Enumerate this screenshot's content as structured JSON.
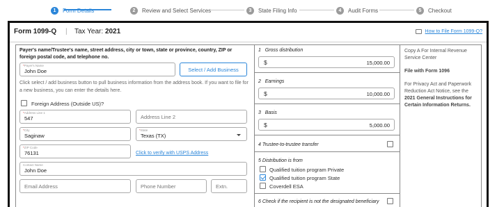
{
  "stepper": {
    "steps": [
      {
        "num": "1",
        "label": "Form Details"
      },
      {
        "num": "2",
        "label": "Review and Select Services"
      },
      {
        "num": "3",
        "label": "State Filing Info"
      },
      {
        "num": "4",
        "label": "Audit Forms"
      },
      {
        "num": "5",
        "label": "Checkout"
      }
    ],
    "active_index": 0,
    "accent": "#2b86d9"
  },
  "header": {
    "form_title": "Form 1099-Q",
    "separator": "|",
    "tax_year_label": "Tax Year:",
    "tax_year": "2021",
    "howto_link": "How to File Form 1099-Q?"
  },
  "payer": {
    "heading": "Payer's name/Trustee's name, street address, city or town, state or province, country, ZIP or foreign postal code, and telephone no.",
    "name_label": "Payer's Name",
    "name_value": "John Doe",
    "select_business_button": "Select / Add Business",
    "help_text": "Click select / add business button to pull business information from the address book. If you want to file for a new business, you can enter the details here.",
    "foreign_label": "Foreign Address (Outside US)?",
    "address1_label": "Address Line 1",
    "address1_value": "547",
    "address2_placeholder": "Address Line 2",
    "city_label": "City",
    "city_value": "Saginaw",
    "state_label": "State",
    "state_value": "Texas (TX)",
    "zip_label": "ZIP Code",
    "zip_value": "76131",
    "verify_link": "Click to verify with USPS Address",
    "contact_label": "Contact Name",
    "contact_value": "John Doe",
    "email_placeholder": "Email Address",
    "phone_placeholder": "Phone Number",
    "ext_placeholder": "Extn."
  },
  "boxes": {
    "box1_num": "1",
    "box1_label": "Gross distribution",
    "box1_value": "15,000.00",
    "box2_num": "2",
    "box2_label": "Earnings",
    "box2_value": "10,000.00",
    "box3_num": "3",
    "box3_label": "Basis",
    "box3_value": "5,000.00",
    "currency": "$",
    "box4_label": "4 Trustee-to-trustee transfer",
    "box5_label": "5 Distribution is from",
    "box5_options": [
      "Qualified tuition program Private",
      "Qualified tuition program State",
      "Coverdell ESA"
    ],
    "box5_checked": [
      false,
      true,
      false
    ],
    "box6_label": "6 Check if the recipient is not the designated beneficiary"
  },
  "info": {
    "copy_a": "Copy A For Internal Revenue Service Center",
    "file_with": "File with Form 1096",
    "privacy_pre": "For Privacy Act and Paperwork Reduction Act Notice, see the",
    "privacy_bold": "2021 General Instructions for Certain Information Returns."
  }
}
